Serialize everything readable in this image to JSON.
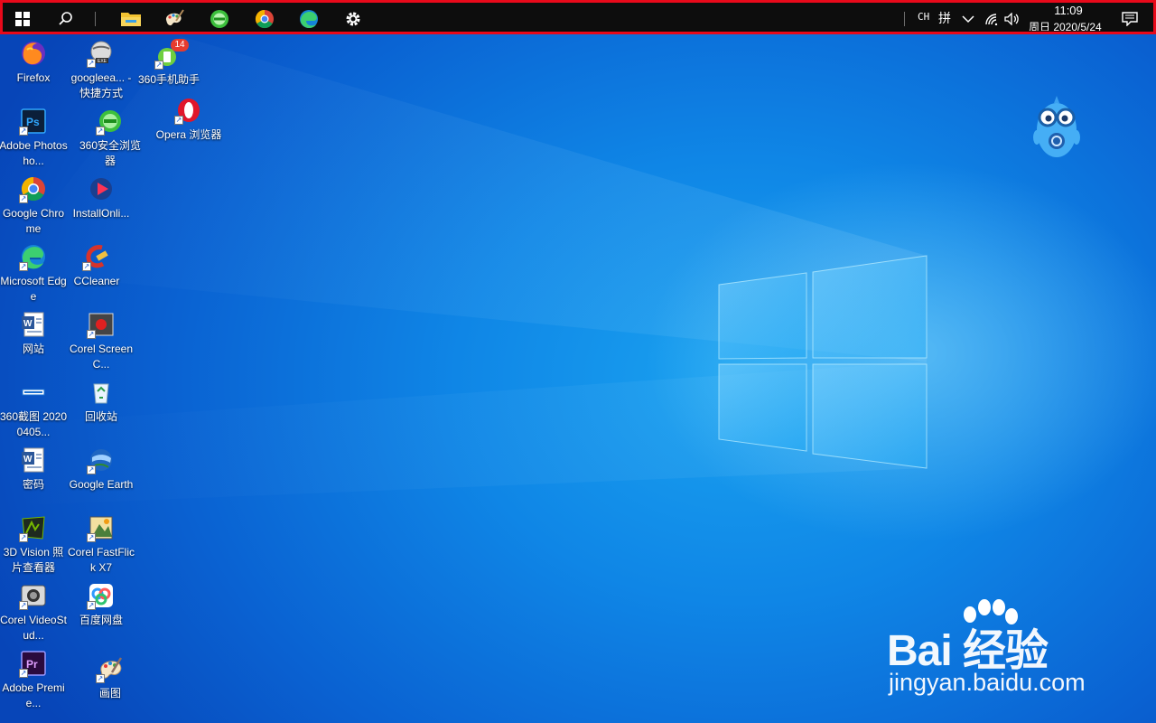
{
  "taskbar": {
    "pinned": [
      "start-icon",
      "search-icon",
      "file-explorer-icon",
      "paint-icon",
      "360-browser-icon",
      "chrome-icon",
      "edge-icon",
      "settings-icon"
    ],
    "tray": {
      "ime_lang": "CH",
      "ime_mode": "拼",
      "time": "11:09",
      "date": "周日 2020/5/24"
    }
  },
  "desktop": {
    "icons": [
      {
        "label": "Firefox"
      },
      {
        "label": "googleea... - 快捷方式"
      },
      {
        "label": "360手机助手",
        "badge": "14"
      },
      {
        "label": "Adobe Photosho..."
      },
      {
        "label": "360安全浏览器"
      },
      {
        "label": "Opera 浏览器"
      },
      {
        "label": "Google Chrome"
      },
      {
        "label": "InstallOnli..."
      },
      {
        "label": "Microsoft Edge"
      },
      {
        "label": "CCleaner"
      },
      {
        "label": "网站"
      },
      {
        "label": "Corel ScreenC..."
      },
      {
        "label": "360截图 20200405..."
      },
      {
        "label": "回收站"
      },
      {
        "label": "密码"
      },
      {
        "label": "Google Earth"
      },
      {
        "label": "3D Vision 照片查看器"
      },
      {
        "label": "Corel FastFlick X7"
      },
      {
        "label": "Corel VideoStud..."
      },
      {
        "label": "百度网盘"
      },
      {
        "label": "Adobe Premie..."
      },
      {
        "label": "画图"
      }
    ]
  },
  "watermark": {
    "brand": "Bai 经验",
    "url": "jingyan.baidu.com"
  }
}
